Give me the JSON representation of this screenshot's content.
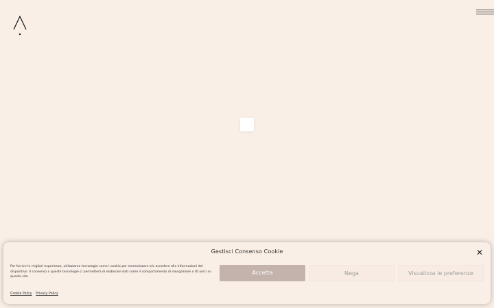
{
  "header": {
    "logo_icon": "lambda-logo-icon",
    "menu_icon": "hamburger-menu-icon"
  },
  "cookie_banner": {
    "title": "Gestisci Consenso Cookie",
    "close_icon": "close-icon",
    "message": "Per fornire le migliori esperienze, utilizziamo tecnologie come i cookie per memorizzare e/o accedere alle informazioni del dispositivo. Il consenso a queste tecnologie ci permetterà di elaborare dati come il comportamento di navigazione o ID unici su questo sito.",
    "accept_label": "Accetta",
    "deny_label": "Nega",
    "preferences_label": "Visualizza le preferenze",
    "links": [
      "Cookie Policy",
      "Privacy Policy"
    ]
  },
  "colors": {
    "background": "#f9efe7",
    "accept_button": "#c4b2ad"
  }
}
